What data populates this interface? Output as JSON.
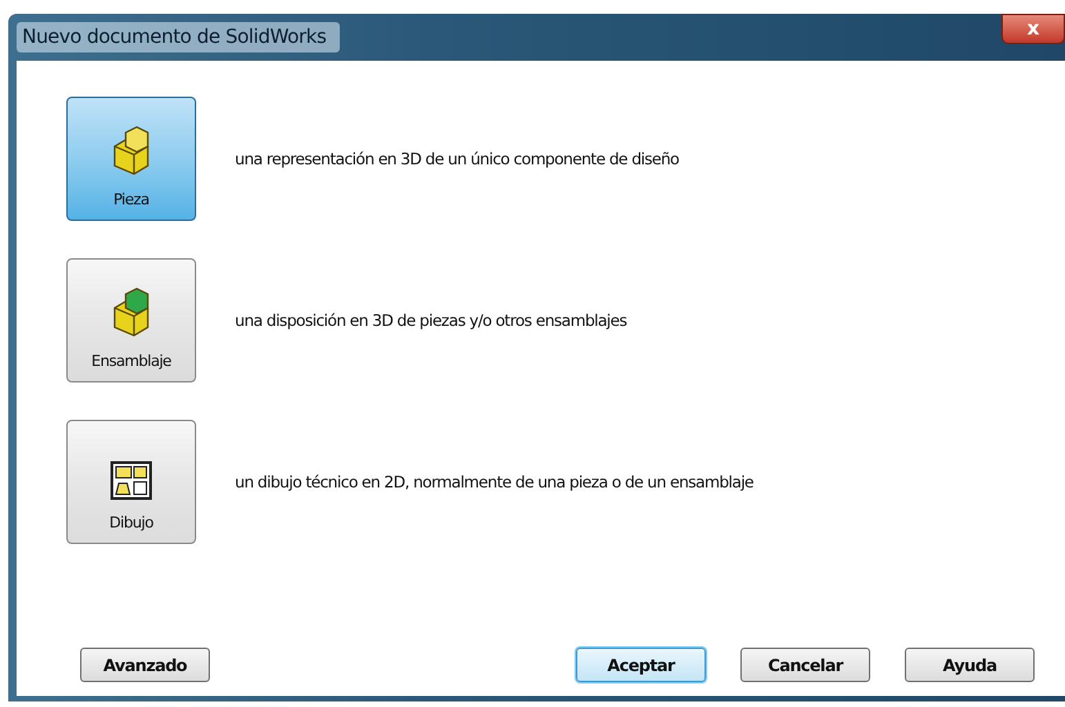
{
  "window": {
    "title": "Nuevo documento de SolidWorks",
    "close": "x"
  },
  "templates": [
    {
      "kind": "part",
      "label": "Pieza",
      "description": "una representación en 3D de un único componente de diseño",
      "selected": true
    },
    {
      "kind": "assembly",
      "label": "Ensamblaje",
      "description": "una disposición en 3D de piezas y/o otros ensamblajes",
      "selected": false
    },
    {
      "kind": "drawing",
      "label": "Dibujo",
      "description": "un dibujo técnico en 2D, normalmente de una pieza o de un ensamblaje",
      "selected": false
    }
  ],
  "buttons": {
    "advanced": "Avanzado",
    "actions": [
      {
        "label": "Aceptar",
        "default": true
      },
      {
        "label": "Cancelar",
        "default": false
      },
      {
        "label": "Ayuda",
        "default": false
      }
    ]
  }
}
